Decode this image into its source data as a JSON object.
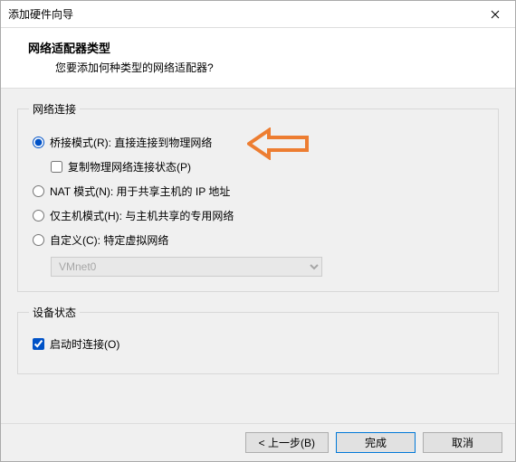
{
  "window": {
    "title": "添加硬件向导"
  },
  "header": {
    "title": "网络适配器类型",
    "subtitle": "您要添加何种类型的网络适配器?"
  },
  "group_network": {
    "legend": "网络连接",
    "bridged": {
      "label": "桥接模式(R): 直接连接到物理网络",
      "replicate_label": "复制物理网络连接状态(P)"
    },
    "nat": {
      "label": "NAT 模式(N): 用于共享主机的 IP 地址"
    },
    "hostonly": {
      "label": "仅主机模式(H): 与主机共享的专用网络"
    },
    "custom": {
      "label": "自定义(C): 特定虚拟网络",
      "selected": "VMnet0"
    }
  },
  "group_device": {
    "legend": "设备状态",
    "connect_on_poweron": "启动时连接(O)"
  },
  "buttons": {
    "back": "< 上一步(B)",
    "finish": "完成",
    "cancel": "取消"
  }
}
